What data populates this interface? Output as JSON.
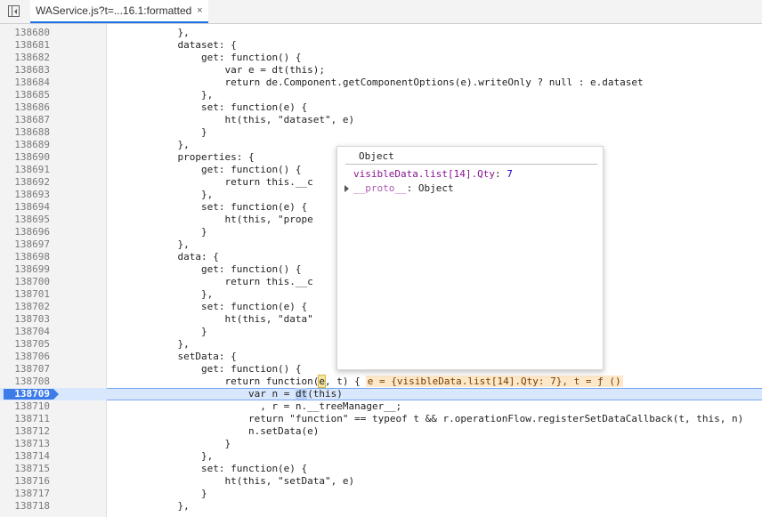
{
  "tab": {
    "title": "WAService.js?t=...16.1:formatted",
    "close": "×"
  },
  "lines": [
    {
      "n": "138680",
      "indent": "            ",
      "text": "},",
      "type": "plain"
    },
    {
      "n": "138681",
      "indent": "            ",
      "text": "dataset: {",
      "type": "plain"
    },
    {
      "n": "138682",
      "indent": "                ",
      "text": "get: function() {",
      "type": "plain"
    },
    {
      "n": "138683",
      "indent": "                    ",
      "text": "var e = dt(this);",
      "type": "plain"
    },
    {
      "n": "138684",
      "indent": "                    ",
      "text": "return de.Component.getComponentOptions(e).writeOnly ? null : e.dataset",
      "type": "plain"
    },
    {
      "n": "138685",
      "indent": "                ",
      "text": "},",
      "type": "plain"
    },
    {
      "n": "138686",
      "indent": "                ",
      "text": "set: function(e) {",
      "type": "plain"
    },
    {
      "n": "138687",
      "indent": "                    ",
      "text": "ht(this, \"dataset\", e)",
      "type": "plain"
    },
    {
      "n": "138688",
      "indent": "                ",
      "text": "}",
      "type": "plain"
    },
    {
      "n": "138689",
      "indent": "            ",
      "text": "},",
      "type": "plain"
    },
    {
      "n": "138690",
      "indent": "            ",
      "text": "properties: {",
      "type": "plain"
    },
    {
      "n": "138691",
      "indent": "                ",
      "text": "get: function() {",
      "type": "plain"
    },
    {
      "n": "138692",
      "indent": "                    ",
      "text": "return this.__c",
      "type": "plain"
    },
    {
      "n": "138693",
      "indent": "                ",
      "text": "},",
      "type": "plain"
    },
    {
      "n": "138694",
      "indent": "                ",
      "text": "set: function(e) {",
      "type": "plain"
    },
    {
      "n": "138695",
      "indent": "                    ",
      "text": "ht(this, \"prope",
      "type": "plain"
    },
    {
      "n": "138696",
      "indent": "                ",
      "text": "}",
      "type": "plain"
    },
    {
      "n": "138697",
      "indent": "            ",
      "text": "},",
      "type": "plain"
    },
    {
      "n": "138698",
      "indent": "            ",
      "text": "data: {",
      "type": "plain"
    },
    {
      "n": "138699",
      "indent": "                ",
      "text": "get: function() {",
      "type": "plain"
    },
    {
      "n": "138700",
      "indent": "                    ",
      "text": "return this.__c",
      "type": "plain"
    },
    {
      "n": "138701",
      "indent": "                ",
      "text": "},",
      "type": "plain"
    },
    {
      "n": "138702",
      "indent": "                ",
      "text": "set: function(e) {",
      "type": "plain"
    },
    {
      "n": "138703",
      "indent": "                    ",
      "text": "ht(this, \"data\"",
      "type": "plain"
    },
    {
      "n": "138704",
      "indent": "                ",
      "text": "}",
      "type": "plain"
    },
    {
      "n": "138705",
      "indent": "            ",
      "text": "},",
      "type": "plain"
    },
    {
      "n": "138706",
      "indent": "            ",
      "text": "setData: {",
      "type": "plain"
    },
    {
      "n": "138707",
      "indent": "                ",
      "text": "get: function() {",
      "type": "plain"
    },
    {
      "n": "138708",
      "indent": "                    ",
      "text": "",
      "type": "special"
    },
    {
      "n": "138709",
      "indent": "                        ",
      "text": "",
      "type": "exec"
    },
    {
      "n": "138710",
      "indent": "                          ",
      "text": ", r = n.__treeManager__;",
      "type": "plain"
    },
    {
      "n": "138711",
      "indent": "                        ",
      "text": "return \"function\" == typeof t && r.operationFlow.registerSetDataCallback(t, this, n)",
      "type": "plain"
    },
    {
      "n": "138712",
      "indent": "                        ",
      "text": "n.setData(e)",
      "type": "plain"
    },
    {
      "n": "138713",
      "indent": "                    ",
      "text": "}",
      "type": "plain"
    },
    {
      "n": "138714",
      "indent": "                ",
      "text": "},",
      "type": "plain"
    },
    {
      "n": "138715",
      "indent": "                ",
      "text": "set: function(e) {",
      "type": "plain"
    },
    {
      "n": "138716",
      "indent": "                    ",
      "text": "ht(this, \"setData\", e)",
      "type": "plain"
    },
    {
      "n": "138717",
      "indent": "                ",
      "text": "}",
      "type": "plain"
    },
    {
      "n": "138718",
      "indent": "            ",
      "text": "},",
      "type": "plain"
    }
  ],
  "line_138708": {
    "pre": "return function(",
    "param": "e",
    "post": ", t) {",
    "inline_value": "e = {visibleData.list[14].Qty: 7}, t = ƒ ()"
  },
  "line_138709": {
    "pre": "var n = ",
    "sel": "dt",
    "post": "(this)"
  },
  "popover": {
    "title": "Object",
    "entry_key": "visibleData.list[14].Qty",
    "entry_sep": ": ",
    "entry_value": "7",
    "proto_key": "__proto__",
    "proto_sep": ": ",
    "proto_value": "Object"
  }
}
